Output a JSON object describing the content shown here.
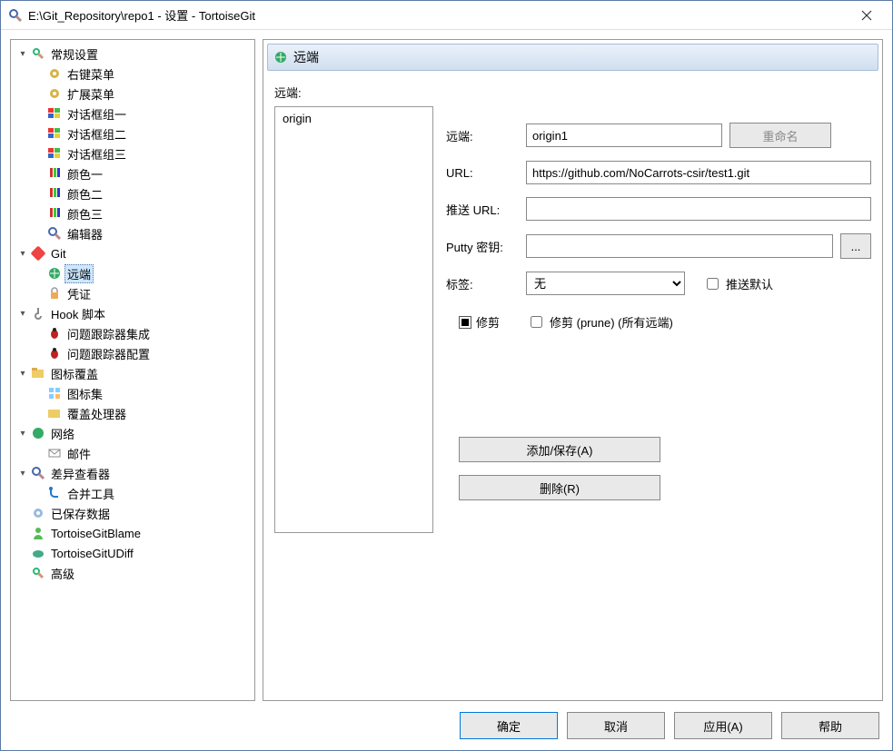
{
  "window": {
    "title": "E:\\Git_Repository\\repo1 - 设置 - TortoiseGit"
  },
  "tree": {
    "general": "常规设置",
    "context_menu": "右键菜单",
    "ext_menu": "扩展菜单",
    "dlg_group1": "对话框组一",
    "dlg_group2": "对话框组二",
    "dlg_group3": "对话框组三",
    "color1": "颜色一",
    "color2": "颜色二",
    "color3": "颜色三",
    "editor": "编辑器",
    "git": "Git",
    "remote": "远端",
    "cred": "凭证",
    "hook": "Hook 脚本",
    "issue_int": "问题跟踪器集成",
    "issue_cfg": "问题跟踪器配置",
    "overlay": "图标覆盖",
    "icon_set": "图标集",
    "overlay_handler": "覆盖处理器",
    "network": "网络",
    "mail": "邮件",
    "diff": "差异查看器",
    "merge_tool": "合并工具",
    "saved_data": "已保存数据",
    "blame": "TortoiseGitBlame",
    "udiff": "TortoiseGitUDiff",
    "advanced": "高级"
  },
  "header": {
    "title": "远端"
  },
  "form": {
    "list_label": "远端:",
    "list_items": [
      "origin"
    ],
    "remote_label": "远端:",
    "remote_value": "origin1",
    "rename_btn": "重命名",
    "url_label": "URL:",
    "url_value": "https://github.com/NoCarrots-csir/test1.git",
    "push_url_label": "推送 URL:",
    "push_url_value": "",
    "putty_label": "Putty 密钥:",
    "putty_value": "",
    "browse_btn": "...",
    "tag_label": "标签:",
    "tag_options": [
      "无"
    ],
    "tag_selected": "无",
    "push_default_label": "推送默认",
    "prune_label": "修剪",
    "prune_all_label": "修剪 (prune)  (所有远端)",
    "add_save_btn": "添加/保存(A)",
    "delete_btn": "删除(R)"
  },
  "buttons": {
    "ok": "确定",
    "cancel": "取消",
    "apply": "应用(A)",
    "help": "帮助"
  }
}
